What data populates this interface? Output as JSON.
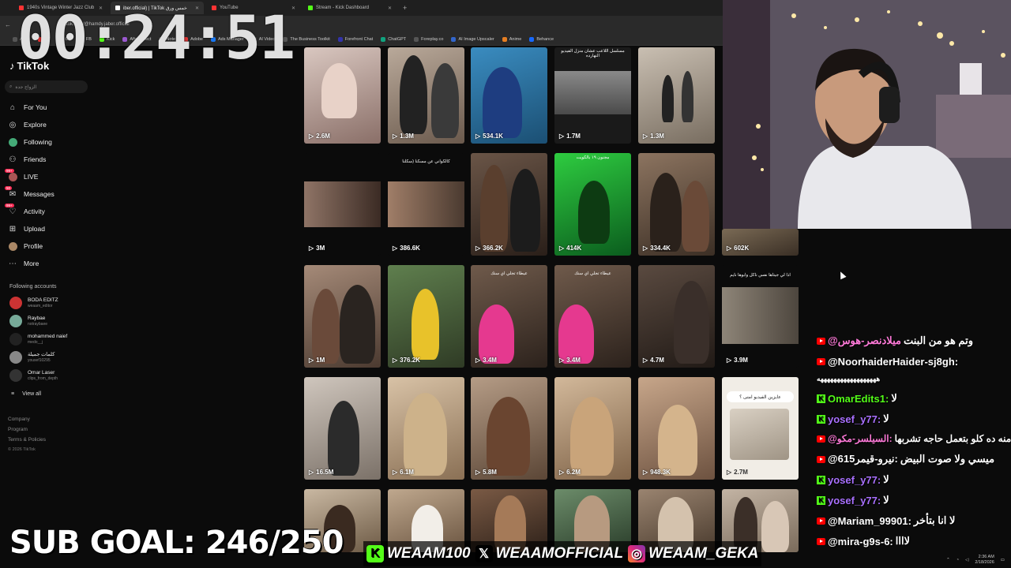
{
  "browser": {
    "tabs": [
      {
        "title": "1940s Vintage Winter Jazz Club",
        "color": "#ff3333",
        "active": false
      },
      {
        "title": "iber.official) | TikTok خمس ورق",
        "color": "#ffffff",
        "active": true
      },
      {
        "title": "YouTube",
        "color": "#ff3333",
        "active": false
      },
      {
        "title": "Stream - Kick Dashboard",
        "color": "#53fc18",
        "active": false
      }
    ],
    "new_tab": "+",
    "url": "tiktok.com/@hamdy.jaber.official",
    "bookmarks": [
      "Apps",
      "YT",
      "Gg",
      "FB",
      "Kick",
      "After Effect",
      "Note",
      "Adobe",
      "Ads Manager",
      "AI Video",
      "The Business Toolkit",
      "Forefront Chat",
      "ChatGPT",
      "Foreplay.co",
      "AI Image Upscaler",
      "Anime",
      "Behance"
    ]
  },
  "timer": "00:24:51",
  "tiktok": {
    "logo": "TikTok",
    "search_placeholder": "الزواج جدة",
    "nav": [
      {
        "label": "For You",
        "icon": "home-icon"
      },
      {
        "label": "Explore",
        "icon": "compass-icon"
      },
      {
        "label": "Following",
        "icon": "following-icon"
      },
      {
        "label": "Friends",
        "icon": "friends-icon"
      },
      {
        "label": "LIVE",
        "icon": "live-icon",
        "badge": "99+"
      },
      {
        "label": "Messages",
        "icon": "messages-icon",
        "badge": "50"
      },
      {
        "label": "Activity",
        "icon": "activity-icon",
        "badge": "99+"
      },
      {
        "label": "Upload",
        "icon": "upload-icon"
      },
      {
        "label": "Profile",
        "icon": "profile-icon"
      },
      {
        "label": "More",
        "icon": "more-icon"
      }
    ],
    "following_label": "Following accounts",
    "following": [
      {
        "name": "BODA EDITZ",
        "handle": "weaam_editor"
      },
      {
        "name": "Raybae",
        "handle": "notraybaee"
      },
      {
        "name": "mohammed naief",
        "handle": "medo__j"
      },
      {
        "name": "كلمات جميلة",
        "handle": "yousef10295"
      },
      {
        "name": "Omar Laser",
        "handle": "clips_from_depth"
      }
    ],
    "view_all": "View all",
    "footer": [
      "Company",
      "Program",
      "Terms & Policies"
    ],
    "copyright": "© 2026 TikTok"
  },
  "videos": [
    "2.6M",
    "1.3M",
    "534.1K",
    "1.7M",
    "1.3M",
    "3M",
    "386.6K",
    "366.2K",
    "414K",
    "334.4K",
    "602K",
    "1M",
    "376.2K",
    "3.4M",
    "3.4M",
    "4.7M",
    "3.9M",
    "16.5M",
    "6.1M",
    "5.8M",
    "6.2M",
    "948.3K",
    "2.7M"
  ],
  "video_captions": {
    "r0c3": "مسلسل اللاعب عشان منزل الفيديو النهارده",
    "r1c1": "كالكواني عن مسكنا (سكلنا",
    "r1c3": "مجنون ١٩ بالكويت",
    "r2c2": "عيطاء تجلي اي سنك",
    "r2c3": "عيطاء تجلي اي سنك",
    "r2c5": "اذا لي جيتاها نفس ناكل وابوها نايم",
    "r3c5": "عايزين الفيديو امتى ؟"
  },
  "chat": [
    {
      "src": "yt",
      "user": "@ميلادنصر-هوس",
      "text": "وتم هو من البنت",
      "color": "#ff7ad9"
    },
    {
      "src": "yt",
      "user": "@NoorhaiderHaider-sj8gh:",
      "text": "",
      "color": "#ffffff"
    },
    {
      "src": "none",
      "user": "",
      "text": "ههههههههههههههههههه",
      "color": "#ffffff"
    },
    {
      "src": "kick",
      "user": "OmarEdits1:",
      "text": "لا",
      "color": "#53fc18"
    },
    {
      "src": "kick",
      "user": "yosef_y77:",
      "text": "لا",
      "color": "#a970ff"
    },
    {
      "src": "yt",
      "user": "@السيلسر-مكو:",
      "text": "منه ده كلو بتعمل حاجه تشربها",
      "color": "#ff7ad9"
    },
    {
      "src": "yt",
      "user": "@615نيرو-قيمر:",
      "text": "ميسي ولا صوت البيض",
      "color": "#ffffff"
    },
    {
      "src": "kick",
      "user": "yosef_y77:",
      "text": "لا",
      "color": "#a970ff"
    },
    {
      "src": "kick",
      "user": "yosef_y77:",
      "text": "لا",
      "color": "#a970ff"
    },
    {
      "src": "yt",
      "user": "@Mariam_99901:",
      "text": "لا انا بتأخر",
      "color": "#ffffff"
    },
    {
      "src": "yt",
      "user": "@mira-g9s-6:",
      "text": "لاااا",
      "color": "#ffffff"
    }
  ],
  "sub_goal": "SUB GOAL: 246/250",
  "socials": [
    {
      "platform": "kick",
      "handle": "WEAAM100",
      "icon": "kick-icon"
    },
    {
      "platform": "x",
      "handle": "WEAAMOFFICIAL",
      "icon": "x-icon"
    },
    {
      "platform": "instagram",
      "handle": "WEAAM_GEKA",
      "icon": "instagram-icon"
    }
  ],
  "taskbar": {
    "time": "2:36 AM",
    "date": "2/18/2026"
  },
  "colors": {
    "kick": "#53fc18",
    "youtube": "#ff0000",
    "tiktok_accent": "#fe2c55"
  }
}
